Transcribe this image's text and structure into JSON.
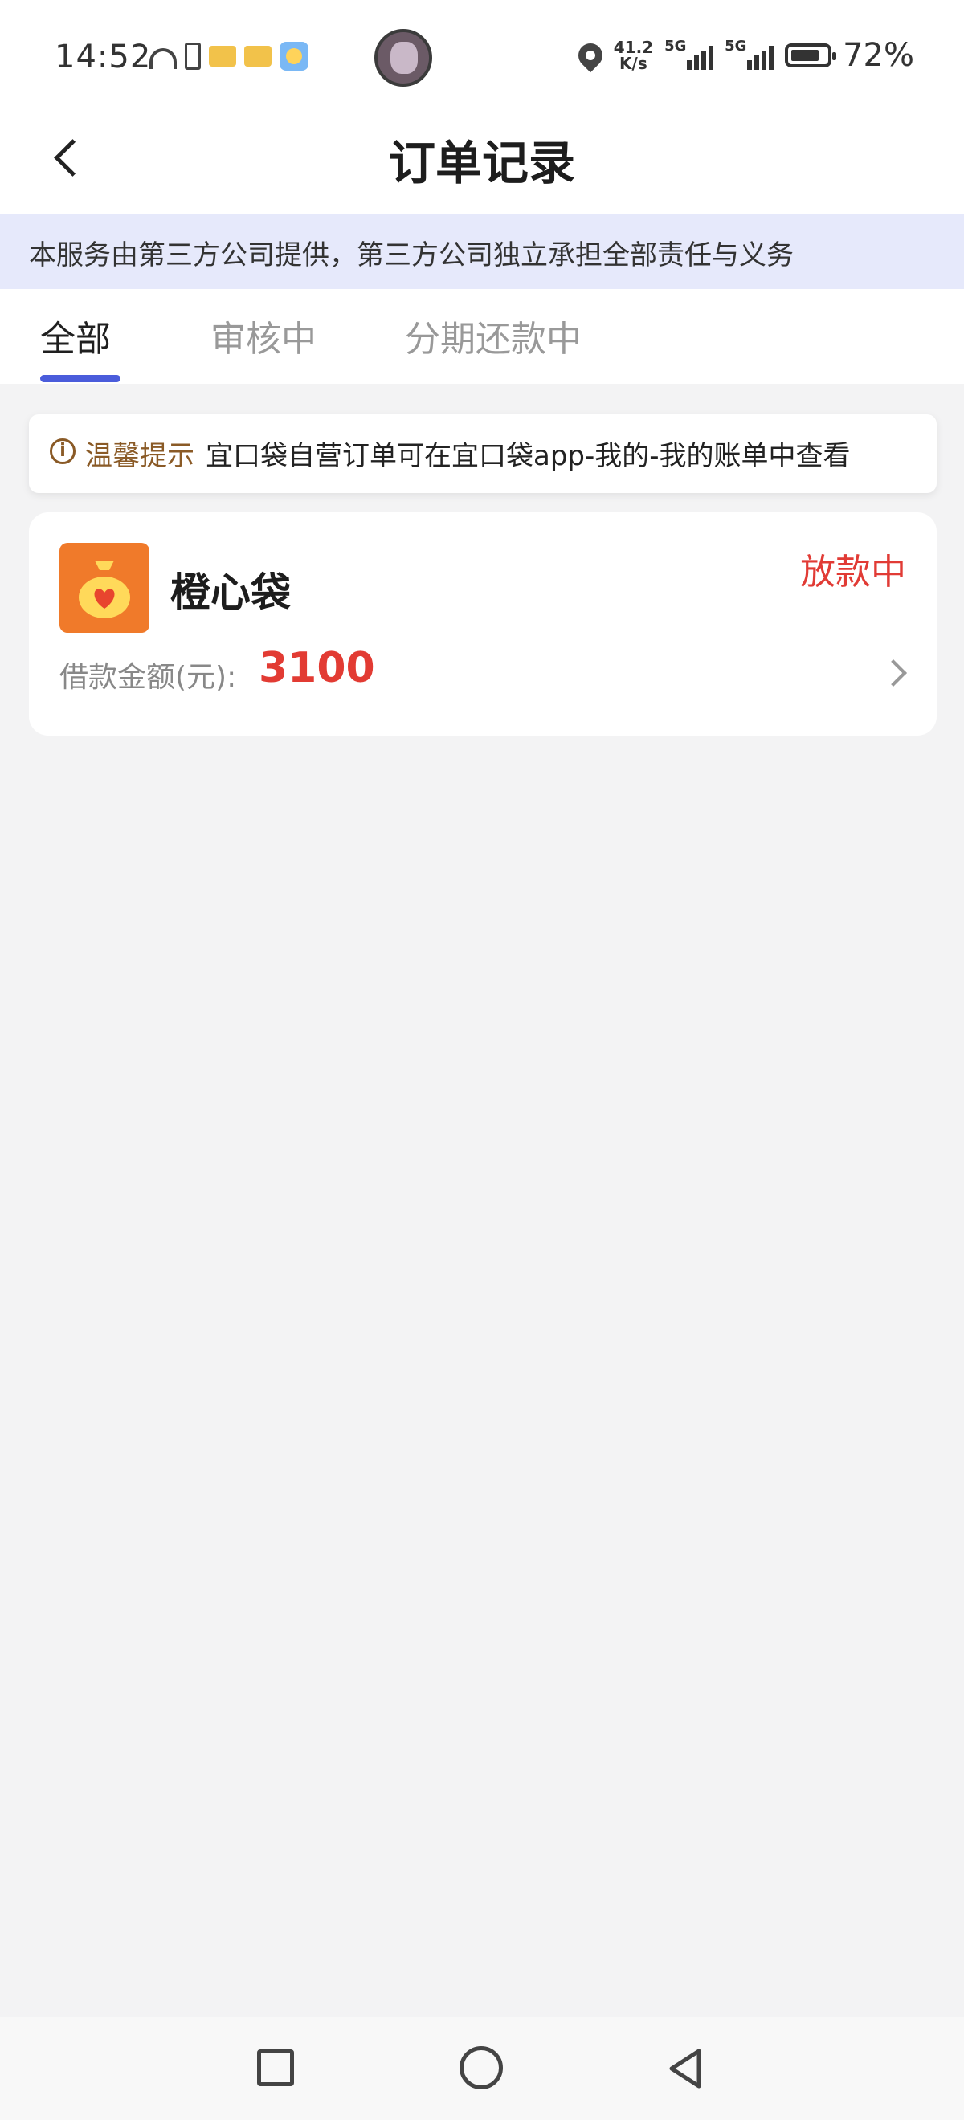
{
  "status_bar": {
    "time": "14:52",
    "network_speed_value": "41.2",
    "network_speed_unit": "K/s",
    "signal_1_label": "5G",
    "signal_2_label": "5G",
    "battery_percent": "72%"
  },
  "header": {
    "title": "订单记录"
  },
  "disclaimer": {
    "text": "本服务由第三方公司提供，第三方公司独立承担全部责任与义务"
  },
  "tabs": [
    {
      "label": "全部",
      "active": true
    },
    {
      "label": "审核中",
      "active": false
    },
    {
      "label": "分期还款中",
      "active": false
    }
  ],
  "tip": {
    "icon": "info-icon",
    "label": "温馨提示",
    "text": "宜口袋自营订单可在宜口袋app-我的-我的账单中查看"
  },
  "orders": [
    {
      "app_name": "橙心袋",
      "status": "放款中",
      "amount_label": "借款金额(元):",
      "amount": "3100"
    }
  ],
  "colors": {
    "accent": "#4a5cdb",
    "status_red": "#e13b35",
    "tip_brown": "#8a5a26",
    "logo_orange": "#f07a2a",
    "disclaimer_bg": "#e6e9fb"
  }
}
